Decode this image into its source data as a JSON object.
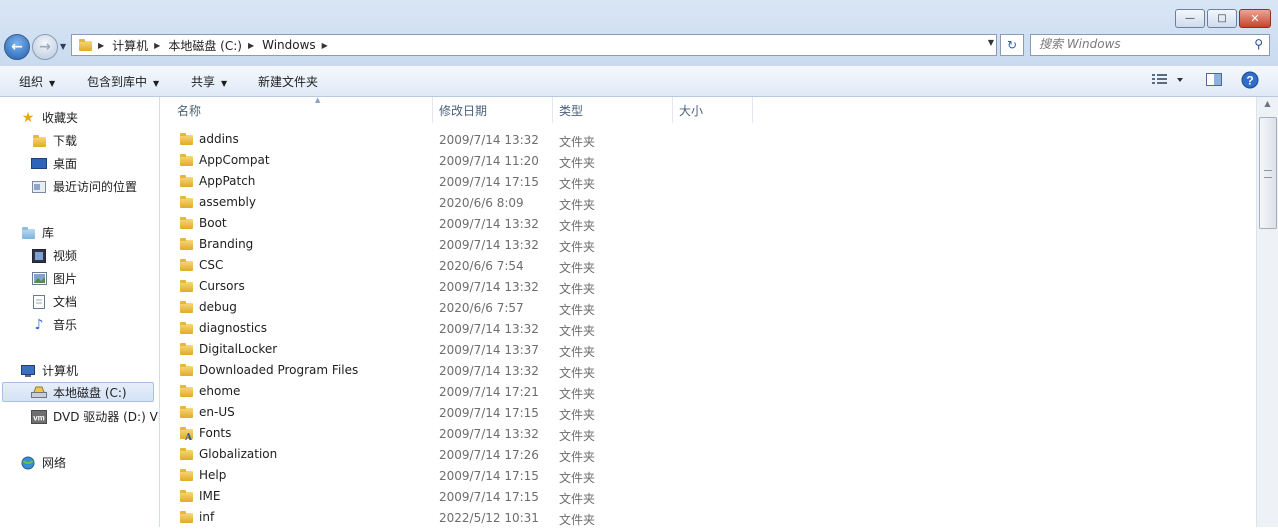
{
  "window": {
    "minimize_glyph": "—",
    "maximize_glyph": "□",
    "close_glyph": "✕"
  },
  "nav": {
    "back_glyph": "←",
    "forward_glyph": "→",
    "refresh_glyph": "↻"
  },
  "address": {
    "segments": [
      "计算机",
      "本地磁盘 (C:)",
      "Windows"
    ]
  },
  "search": {
    "placeholder": "搜索 Windows"
  },
  "toolbar": {
    "organize": "组织",
    "include_in_library": "包含到库中",
    "share": "共享",
    "new_folder": "新建文件夹"
  },
  "sidebar": {
    "favorites": {
      "label": "收藏夹",
      "items": [
        "下载",
        "桌面",
        "最近访问的位置"
      ]
    },
    "libraries": {
      "label": "库",
      "items": [
        "视频",
        "图片",
        "文档",
        "音乐"
      ]
    },
    "computer": {
      "label": "计算机",
      "items": [
        "本地磁盘 (C:)",
        "DVD 驱动器 (D:) VMware Tools"
      ]
    },
    "network": {
      "label": "网络"
    }
  },
  "columns": {
    "name": "名称",
    "date": "修改日期",
    "type": "类型",
    "size": "大小"
  },
  "files": [
    {
      "name": "addins",
      "date": "2009/7/14 13:32",
      "type": "文件夹"
    },
    {
      "name": "AppCompat",
      "date": "2009/7/14 11:20",
      "type": "文件夹"
    },
    {
      "name": "AppPatch",
      "date": "2009/7/14 17:15",
      "type": "文件夹"
    },
    {
      "name": "assembly",
      "date": "2020/6/6 8:09",
      "type": "文件夹"
    },
    {
      "name": "Boot",
      "date": "2009/7/14 13:32",
      "type": "文件夹"
    },
    {
      "name": "Branding",
      "date": "2009/7/14 13:32",
      "type": "文件夹"
    },
    {
      "name": "CSC",
      "date": "2020/6/6 7:54",
      "type": "文件夹"
    },
    {
      "name": "Cursors",
      "date": "2009/7/14 13:32",
      "type": "文件夹"
    },
    {
      "name": "debug",
      "date": "2020/6/6 7:57",
      "type": "文件夹"
    },
    {
      "name": "diagnostics",
      "date": "2009/7/14 13:32",
      "type": "文件夹"
    },
    {
      "name": "DigitalLocker",
      "date": "2009/7/14 13:37",
      "type": "文件夹"
    },
    {
      "name": "Downloaded Program Files",
      "date": "2009/7/14 13:32",
      "type": "文件夹"
    },
    {
      "name": "ehome",
      "date": "2009/7/14 17:21",
      "type": "文件夹"
    },
    {
      "name": "en-US",
      "date": "2009/7/14 17:15",
      "type": "文件夹"
    },
    {
      "name": "Fonts",
      "date": "2009/7/14 13:32",
      "type": "文件夹"
    },
    {
      "name": "Globalization",
      "date": "2009/7/14 17:26",
      "type": "文件夹"
    },
    {
      "name": "Help",
      "date": "2009/7/14 17:15",
      "type": "文件夹"
    },
    {
      "name": "IME",
      "date": "2009/7/14 17:15",
      "type": "文件夹"
    },
    {
      "name": "inf",
      "date": "2022/5/12 10:31",
      "type": "文件夹"
    }
  ],
  "colors": {
    "accent": "#1f5fb4",
    "folder": "#e0ab28",
    "muted_text": "#6d6d6d"
  }
}
